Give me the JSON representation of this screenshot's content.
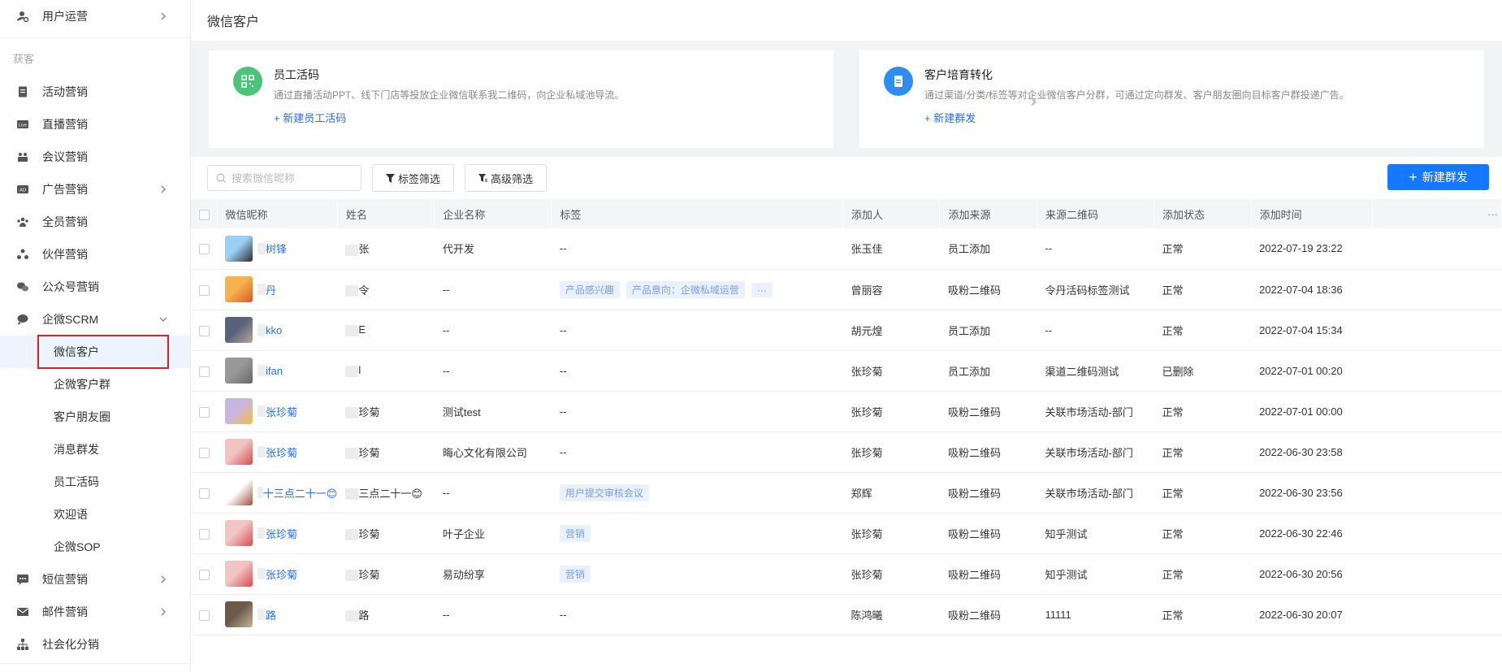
{
  "sidebar": {
    "top_item": "用户运营",
    "group_label": "获客",
    "items": [
      {
        "label": "活动营销",
        "icon": "document-icon",
        "arrow": false
      },
      {
        "label": "直播营销",
        "icon": "live-icon",
        "arrow": false
      },
      {
        "label": "会议营销",
        "icon": "meeting-icon",
        "arrow": false
      },
      {
        "label": "广告营销",
        "icon": "ad-icon",
        "arrow": true
      },
      {
        "label": "全员营销",
        "icon": "team-icon",
        "arrow": false
      },
      {
        "label": "伙伴营销",
        "icon": "partner-icon",
        "arrow": false
      },
      {
        "label": "公众号营销",
        "icon": "wechat-icon",
        "arrow": false
      },
      {
        "label": "企微SCRM",
        "icon": "chat-icon",
        "arrow": "down"
      }
    ],
    "sub_items": [
      "微信客户",
      "企微客户群",
      "客户朋友圈",
      "消息群发",
      "员工活码",
      "欢迎语",
      "企微SOP"
    ],
    "bottom_items": [
      {
        "label": "短信营销",
        "icon": "sms-icon",
        "arrow": true
      },
      {
        "label": "邮件营销",
        "icon": "mail-icon",
        "arrow": true
      },
      {
        "label": "社会化分销",
        "icon": "hierarchy-icon",
        "arrow": false
      }
    ]
  },
  "page": {
    "title": "微信客户"
  },
  "cards": [
    {
      "title": "员工活码",
      "desc": "通过直播活动PPT、线下门店等投放企业微信联系我二维码，向企业私域池导流。",
      "link": "+ 新建员工活码",
      "color": "#4cc27a"
    },
    {
      "title": "客户培育转化",
      "desc": "通过渠道/分类/标签等对企业微信客户分群，可通过定向群发、客户朋友圈向目标客户群投递广告。",
      "link": "+ 新建群发",
      "color": "#2f8cf0"
    }
  ],
  "arrows_between": "»",
  "toolbar": {
    "search_placeholder": "搜索微信昵称",
    "tag_filter": "标签筛选",
    "advanced_filter": "高级筛选",
    "new_broadcast": "新建群发"
  },
  "table": {
    "columns": [
      "微信昵称",
      "姓名",
      "企业名称",
      "标签",
      "添加人",
      "添加来源",
      "来源二维码",
      "添加状态",
      "添加时间"
    ],
    "more": "···",
    "rows": [
      {
        "nick": "树锋",
        "name": "张",
        "company": "代开发",
        "tags": [
          "--"
        ],
        "adder": "张玉佳",
        "source": "员工添加",
        "qrcode": "--",
        "status": "正常",
        "time": "2022-07-19 23:22",
        "av": [
          "#9ad0f5",
          "#2b2b2b"
        ]
      },
      {
        "nick": "丹",
        "name": "令",
        "company": "--",
        "tags": [
          "产品感兴趣",
          "产品意向：企微私域运营",
          "···"
        ],
        "adder": "曾丽容",
        "source": "吸粉二维码",
        "qrcode": "令丹活码标签测试",
        "status": "正常",
        "time": "2022-07-04 18:36",
        "av": [
          "#f6b24d",
          "#d9572b"
        ]
      },
      {
        "nick": "kko",
        "name": "E",
        "company": "--",
        "tags": [
          "--"
        ],
        "adder": "胡元煌",
        "source": "员工添加",
        "qrcode": "--",
        "status": "正常",
        "time": "2022-07-04 15:34",
        "av": [
          "#58627a",
          "#b9a79a"
        ]
      },
      {
        "nick": "ifan",
        "name": "l",
        "company": "--",
        "tags": [
          "--"
        ],
        "adder": "张珍菊",
        "source": "员工添加",
        "qrcode": "渠道二维码测试",
        "status": "已删除",
        "time": "2022-07-01 00:20",
        "av": [
          "#999",
          "#666"
        ]
      },
      {
        "nick": "张珍菊",
        "name": "珍菊",
        "company": "测试test",
        "tags": [
          "--"
        ],
        "adder": "张珍菊",
        "source": "吸粉二维码",
        "qrcode": "关联市场活动-部门",
        "status": "正常",
        "time": "2022-07-01 00:00",
        "av": [
          "#c9b6e0",
          "#f0c040"
        ]
      },
      {
        "nick": "张珍菊",
        "name": "珍菊",
        "company": "晦心文化有限公司",
        "tags": [
          "--"
        ],
        "adder": "张珍菊",
        "source": "吸粉二维码",
        "qrcode": "关联市场活动-部门",
        "status": "正常",
        "time": "2022-06-30 23:58",
        "av": [
          "#f2c4c4",
          "#d84a4a"
        ]
      },
      {
        "nick": "十三点二十一😊",
        "name": "三点二十一😊",
        "company": "--",
        "tags": [
          "用户提交审核会议"
        ],
        "adder": "郑辉",
        "source": "吸粉二维码",
        "qrcode": "关联市场活动-部门",
        "status": "正常",
        "time": "2022-06-30 23:56",
        "av": [
          "#fff",
          "#a0523d"
        ]
      },
      {
        "nick": "张珍菊",
        "name": "珍菊",
        "company": "叶子企业",
        "tags": [
          "营销"
        ],
        "adder": "张珍菊",
        "source": "吸粉二维码",
        "qrcode": "知乎测试",
        "status": "正常",
        "time": "2022-06-30 22:46",
        "av": [
          "#f2c4c4",
          "#d84a4a"
        ]
      },
      {
        "nick": "张珍菊",
        "name": "珍菊",
        "company": "易动纷享",
        "tags": [
          "营销"
        ],
        "adder": "张珍菊",
        "source": "吸粉二维码",
        "qrcode": "知乎测试",
        "status": "正常",
        "time": "2022-06-30 20:56",
        "av": [
          "#f2c4c4",
          "#d84a4a"
        ]
      },
      {
        "nick": "路",
        "name": "路",
        "company": "--",
        "tags": [
          "--"
        ],
        "adder": "陈鸿曦",
        "source": "吸粉二维码",
        "qrcode": "11111",
        "status": "正常",
        "time": "2022-06-30 20:07",
        "av": [
          "#6b5a4a",
          "#c7b49a"
        ]
      }
    ]
  },
  "colors": {
    "accent": "#1677ff",
    "link": "#2c6ee8",
    "highlight_box": "#e02020",
    "active_bg": "#eef4ff"
  }
}
